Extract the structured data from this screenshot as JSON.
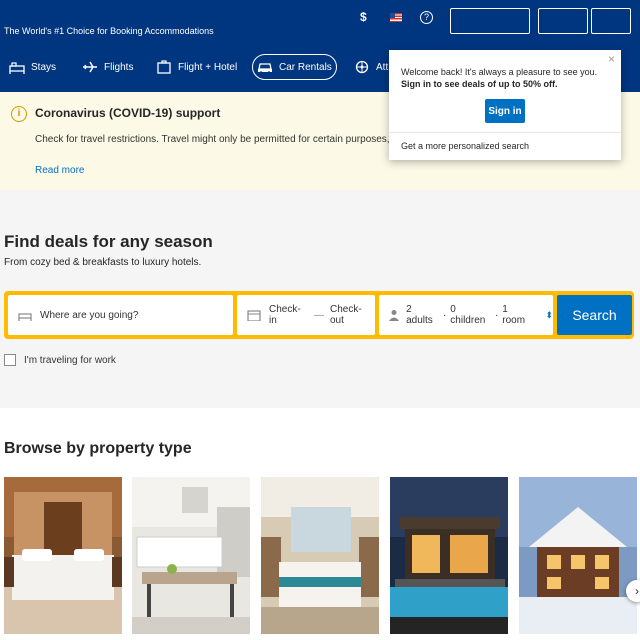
{
  "header": {
    "tagline": "The World's #1 Choice for Booking Accommodations",
    "currency": "$",
    "help_icon": "?",
    "register_label": "",
    "signin_label": ""
  },
  "nav": [
    {
      "label": "Stays",
      "icon": "bed-icon",
      "active": false
    },
    {
      "label": "Flights",
      "icon": "plane-icon",
      "active": false
    },
    {
      "label": "Flight + Hotel",
      "icon": "suitcase-icon",
      "active": false
    },
    {
      "label": "Car Rentals",
      "icon": "car-icon",
      "active": true
    },
    {
      "label": "Att",
      "icon": "attractions-icon",
      "active": false
    }
  ],
  "covid": {
    "title": "Coronavirus (COVID-19) support",
    "text": "Check for travel restrictions. Travel might only be permitted for certain purposes, and tourist",
    "link": "Read more"
  },
  "popup": {
    "text_pre": "Welcome back! It's always a pleasure to see you. ",
    "text_bold": "Sign in to see deals of up to 50% off.",
    "signin": "Sign in",
    "footer": "Get a more personalized search"
  },
  "hero": {
    "title": "Find deals for any season",
    "subtitle": "From cozy bed & breakfasts to luxury hotels."
  },
  "search": {
    "destination_placeholder": "Where are you going?",
    "checkin": "Check-in",
    "separator": "—",
    "checkout": "Check-out",
    "adults": "2 adults",
    "dot": "·",
    "children": "0 children",
    "rooms": "1 room",
    "button": "Search",
    "work_label": "I'm traveling for work"
  },
  "property": {
    "title": "Browse by property type",
    "images": [
      "hotel-room",
      "apartment-kitchen",
      "resort-room",
      "villa-night",
      "chalet-snow"
    ]
  },
  "colors": {
    "brand": "#003580",
    "accent": "#0071c2",
    "search_border": "#febb02"
  }
}
